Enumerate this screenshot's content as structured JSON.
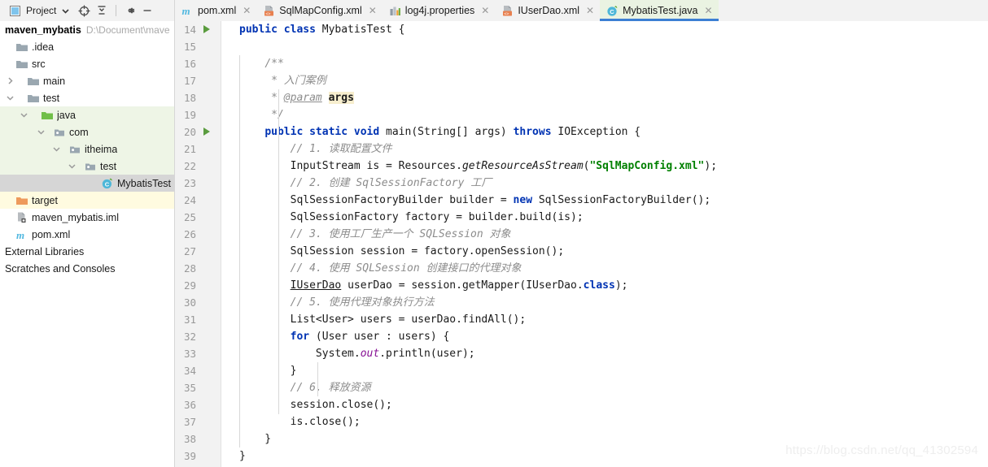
{
  "toolbar": {
    "project_label": "Project",
    "dropdown_icon": "chevron-down-icon",
    "locate_icon": "crosshair-target-icon",
    "collapse_icon": "collapse-all-icon",
    "settings_icon": "gear-icon",
    "hide_icon": "minimize-icon"
  },
  "tabs": [
    {
      "label": "pom.xml",
      "icon": "maven-m-icon",
      "active": false
    },
    {
      "label": "SqlMapConfig.xml",
      "icon": "xml-file-icon",
      "active": false
    },
    {
      "label": "log4j.properties",
      "icon": "properties-icon",
      "active": false
    },
    {
      "label": "IUserDao.xml",
      "icon": "xml-file-icon",
      "active": false
    },
    {
      "label": "MybatisTest.java",
      "icon": "java-class-icon",
      "active": true
    }
  ],
  "project": {
    "name": "maven_mybatis",
    "path": "D:\\Document\\mave",
    "tree": [
      {
        "label": ".idea",
        "icon": "folder-icon",
        "indent": 0,
        "arrow": "none",
        "row": "normal"
      },
      {
        "label": "src",
        "icon": "folder-icon",
        "indent": 0,
        "arrow": "none",
        "row": "normal"
      },
      {
        "label": "main",
        "icon": "folder-icon",
        "indent": 1,
        "arrow": "right",
        "row": "normal"
      },
      {
        "label": "test",
        "icon": "folder-icon",
        "indent": 1,
        "arrow": "down",
        "row": "normal"
      },
      {
        "label": "java",
        "icon": "test-source-folder-icon",
        "indent": 2,
        "arrow": "down",
        "row": "greenbg"
      },
      {
        "label": "com",
        "icon": "package-icon",
        "indent": 3,
        "arrow": "down",
        "row": "greenbg"
      },
      {
        "label": "itheima",
        "icon": "package-icon",
        "indent": 4,
        "arrow": "down",
        "row": "greenbg"
      },
      {
        "label": "test",
        "icon": "package-icon",
        "indent": 5,
        "arrow": "down",
        "row": "greenbg"
      },
      {
        "label": "MybatisTest",
        "icon": "java-class-icon",
        "indent": 6,
        "arrow": "none",
        "row": "selected"
      },
      {
        "label": "target",
        "icon": "excluded-folder-icon",
        "indent": 0,
        "arrow": "none",
        "row": "excluded"
      },
      {
        "label": "maven_mybatis.iml",
        "icon": "iml-file-icon",
        "indent": 0,
        "arrow": "none",
        "row": "normal"
      },
      {
        "label": "pom.xml",
        "icon": "maven-m-icon",
        "indent": 0,
        "arrow": "none",
        "row": "normal"
      },
      {
        "label": "External Libraries",
        "icon": "none",
        "indent": 0,
        "arrow": "none",
        "row": "normal"
      },
      {
        "label": "Scratches and Consoles",
        "icon": "none",
        "indent": 0,
        "arrow": "none",
        "row": "normal"
      }
    ]
  },
  "editor": {
    "first_line": 14,
    "line_numbers": [
      14,
      15,
      16,
      17,
      18,
      19,
      20,
      21,
      22,
      23,
      24,
      25,
      26,
      27,
      28,
      29,
      30,
      31,
      32,
      33,
      34,
      35,
      36,
      37,
      38,
      39
    ],
    "run_marker_lines": [
      14,
      20
    ],
    "lines": [
      {
        "n": 14,
        "text": "public class MybatisTest {"
      },
      {
        "n": 15,
        "text": ""
      },
      {
        "n": 16,
        "text": "    /**"
      },
      {
        "n": 17,
        "text": "     * 入门案例"
      },
      {
        "n": 18,
        "text": "     * @param args"
      },
      {
        "n": 19,
        "text": "     */"
      },
      {
        "n": 20,
        "text": "    public static void main(String[] args) throws IOException {"
      },
      {
        "n": 21,
        "text": "        // 1. 读取配置文件"
      },
      {
        "n": 22,
        "text": "        InputStream is = Resources.getResourceAsStream(\"SqlMapConfig.xml\");"
      },
      {
        "n": 23,
        "text": "        // 2. 创建 SqlSessionFactory 工厂"
      },
      {
        "n": 24,
        "text": "        SqlSessionFactoryBuilder builder = new SqlSessionFactoryBuilder();"
      },
      {
        "n": 25,
        "text": "        SqlSessionFactory factory = builder.build(is);"
      },
      {
        "n": 26,
        "text": "        // 3. 使用工厂生产一个 SQLSession 对象"
      },
      {
        "n": 27,
        "text": "        SqlSession session = factory.openSession();"
      },
      {
        "n": 28,
        "text": "        // 4. 使用 SQLSession 创建接口的代理对象"
      },
      {
        "n": 29,
        "text": "        IUserDao userDao = session.getMapper(IUserDao.class);"
      },
      {
        "n": 30,
        "text": "        // 5. 使用代理对象执行方法"
      },
      {
        "n": 31,
        "text": "        List<User> users = userDao.findAll();"
      },
      {
        "n": 32,
        "text": "        for (User user : users) {"
      },
      {
        "n": 33,
        "text": "            System.out.println(user);"
      },
      {
        "n": 34,
        "text": "        }"
      },
      {
        "n": 35,
        "text": "        // 6. 释放资源"
      },
      {
        "n": 36,
        "text": "        session.close();"
      },
      {
        "n": 37,
        "text": "        is.close();"
      },
      {
        "n": 38,
        "text": "    }"
      },
      {
        "n": 39,
        "text": "}"
      }
    ]
  },
  "watermark": "https://blog.csdn.net/qq_41302594",
  "colors": {
    "keyword": "#0033b3",
    "string": "#008000",
    "comment": "#8c8c8c",
    "field": "#871094",
    "tab_active_bg": "#eaf3e2",
    "tab_underline": "#3c7fd4",
    "tree_green_bg": "#eef5e6",
    "tree_selected_bg": "#d6d6d6",
    "excluded_bg": "#fffbe0"
  }
}
